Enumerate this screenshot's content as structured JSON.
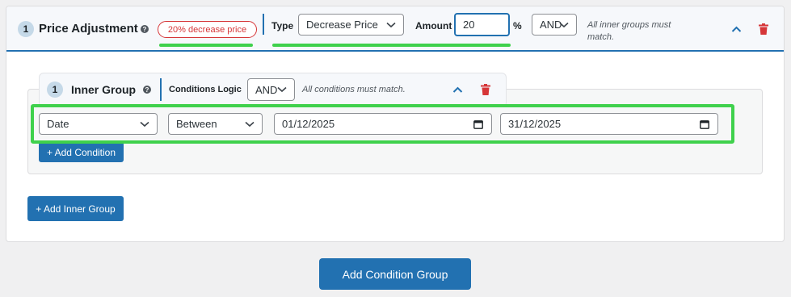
{
  "group": {
    "number": "1",
    "title": "Price Adjustment",
    "help_symbol": "?",
    "badge": "20% decrease price",
    "type_label": "Type",
    "type_value": "Decrease Price",
    "amount_label": "Amount",
    "amount_value": "20",
    "amount_unit": "%",
    "logic_value": "AND",
    "logic_note": "All inner groups must match."
  },
  "inner_group": {
    "number": "1",
    "title": "Inner Group",
    "help_symbol": "?",
    "logic_label": "Conditions Logic",
    "logic_value": "AND",
    "logic_note": "All conditions must match."
  },
  "condition": {
    "field": "Date",
    "operator": "Between",
    "from_date": "01/12/2025",
    "to_date": "31/12/2025"
  },
  "buttons": {
    "add_condition": "+ Add Condition",
    "add_inner_group": "+ Add Inner Group",
    "add_condition_group": "Add Condition Group"
  },
  "colors": {
    "accent": "#2271b1",
    "danger": "#d63638",
    "highlight": "#3fd14c"
  }
}
